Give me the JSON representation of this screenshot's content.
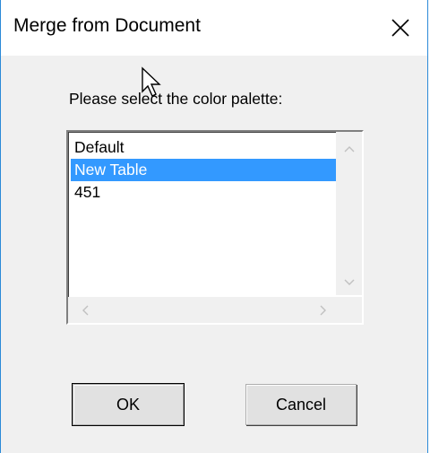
{
  "window": {
    "title": "Merge from Document"
  },
  "dialog": {
    "prompt": "Please select the color palette:",
    "palettes": [
      {
        "label": "Default",
        "selected": false
      },
      {
        "label": "New Table",
        "selected": true
      },
      {
        "label": "451",
        "selected": false
      }
    ],
    "ok_label": "OK",
    "cancel_label": "Cancel"
  },
  "icons": {
    "close": "close-icon",
    "cursor": "mouse-pointer-icon",
    "scroll_up": "chevron-up-icon",
    "scroll_down": "chevron-down-icon",
    "scroll_left": "chevron-left-icon",
    "scroll_right": "chevron-right-icon"
  },
  "colors": {
    "selection": "#3399ff",
    "window_border": "#2b8ad8",
    "dialog_bg": "#f0f0f0"
  }
}
